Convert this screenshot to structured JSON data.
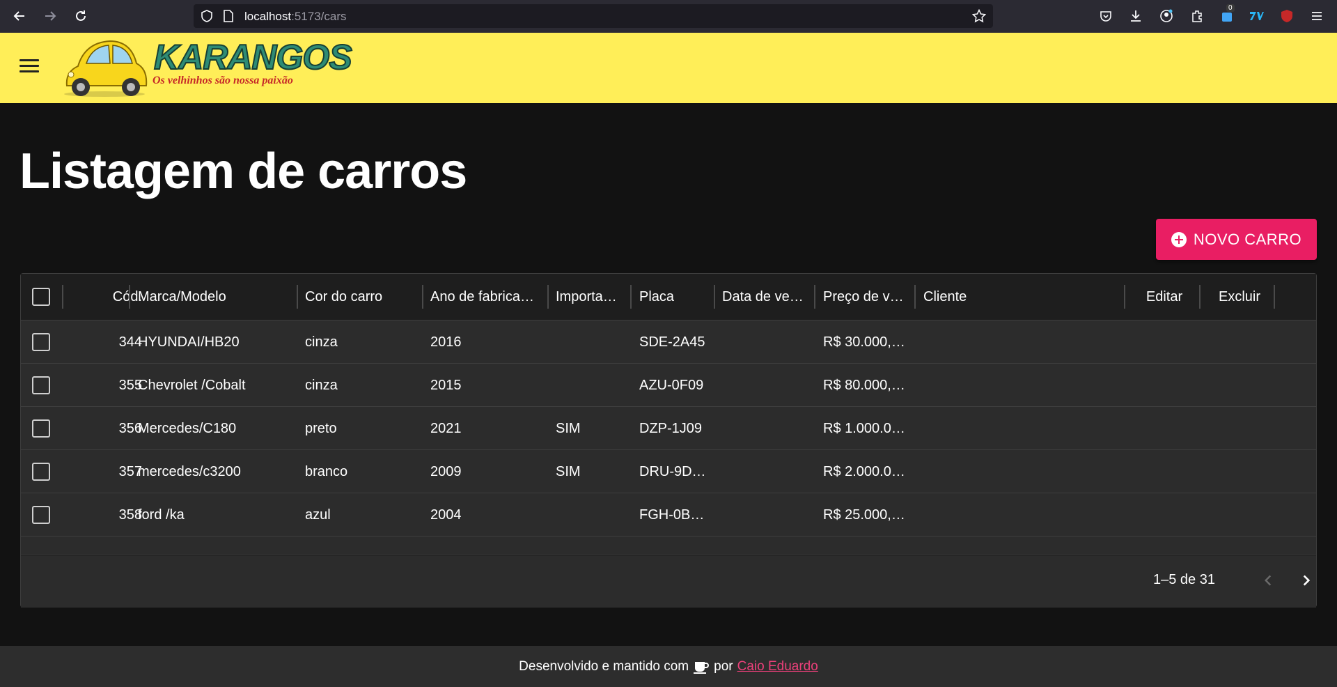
{
  "browser": {
    "url_host": "localhost",
    "url_path": ":5173/cars",
    "ext_badge": "0"
  },
  "app": {
    "logo_title": "KARANGOS",
    "logo_subtitle": "Os velhinhos são nossa paixão"
  },
  "page": {
    "title": "Listagem de carros",
    "new_button_label": "NOVO CARRO"
  },
  "grid": {
    "columns": [
      "Cód.",
      "Marca/Modelo",
      "Cor do carro",
      "Ano de fabrica…",
      "Importa…",
      "Placa",
      "Data de ve…",
      "Preço de v…",
      "Cliente",
      "Editar",
      "Excluir"
    ],
    "rows": [
      {
        "id": "344",
        "modelo": "HYUNDAI/HB20",
        "cor": "cinza",
        "ano": "2016",
        "importado": "",
        "placa": "SDE-2A45",
        "data_venda": "",
        "preco": "R$ 30.000,…",
        "cliente": ""
      },
      {
        "id": "355",
        "modelo": "Chevrolet /Cobalt",
        "cor": "cinza",
        "ano": "2015",
        "importado": "",
        "placa": "AZU-0F09",
        "data_venda": "",
        "preco": "R$ 80.000,…",
        "cliente": ""
      },
      {
        "id": "356",
        "modelo": "Mercedes/C180",
        "cor": "preto",
        "ano": "2021",
        "importado": "SIM",
        "placa": "DZP-1J09",
        "data_venda": "",
        "preco": "R$ 1.000.0…",
        "cliente": ""
      },
      {
        "id": "357",
        "modelo": "mercedes/c3200",
        "cor": "branco",
        "ano": "2009",
        "importado": "SIM",
        "placa": "DRU-9D…",
        "data_venda": "",
        "preco": "R$ 2.000.0…",
        "cliente": ""
      },
      {
        "id": "358",
        "modelo": "ford /ka",
        "cor": "azul",
        "ano": "2004",
        "importado": "",
        "placa": "FGH-0B…",
        "data_venda": "",
        "preco": "R$ 25.000,…",
        "cliente": ""
      }
    ],
    "pagination": "1–5 de 31"
  },
  "footer": {
    "text_before": "Desenvolvido e mantido com",
    "text_por": "por",
    "author": "Caio Eduardo"
  },
  "colors": {
    "appbar": "#ffee58",
    "accent": "#e91e63",
    "background": "#121212"
  }
}
